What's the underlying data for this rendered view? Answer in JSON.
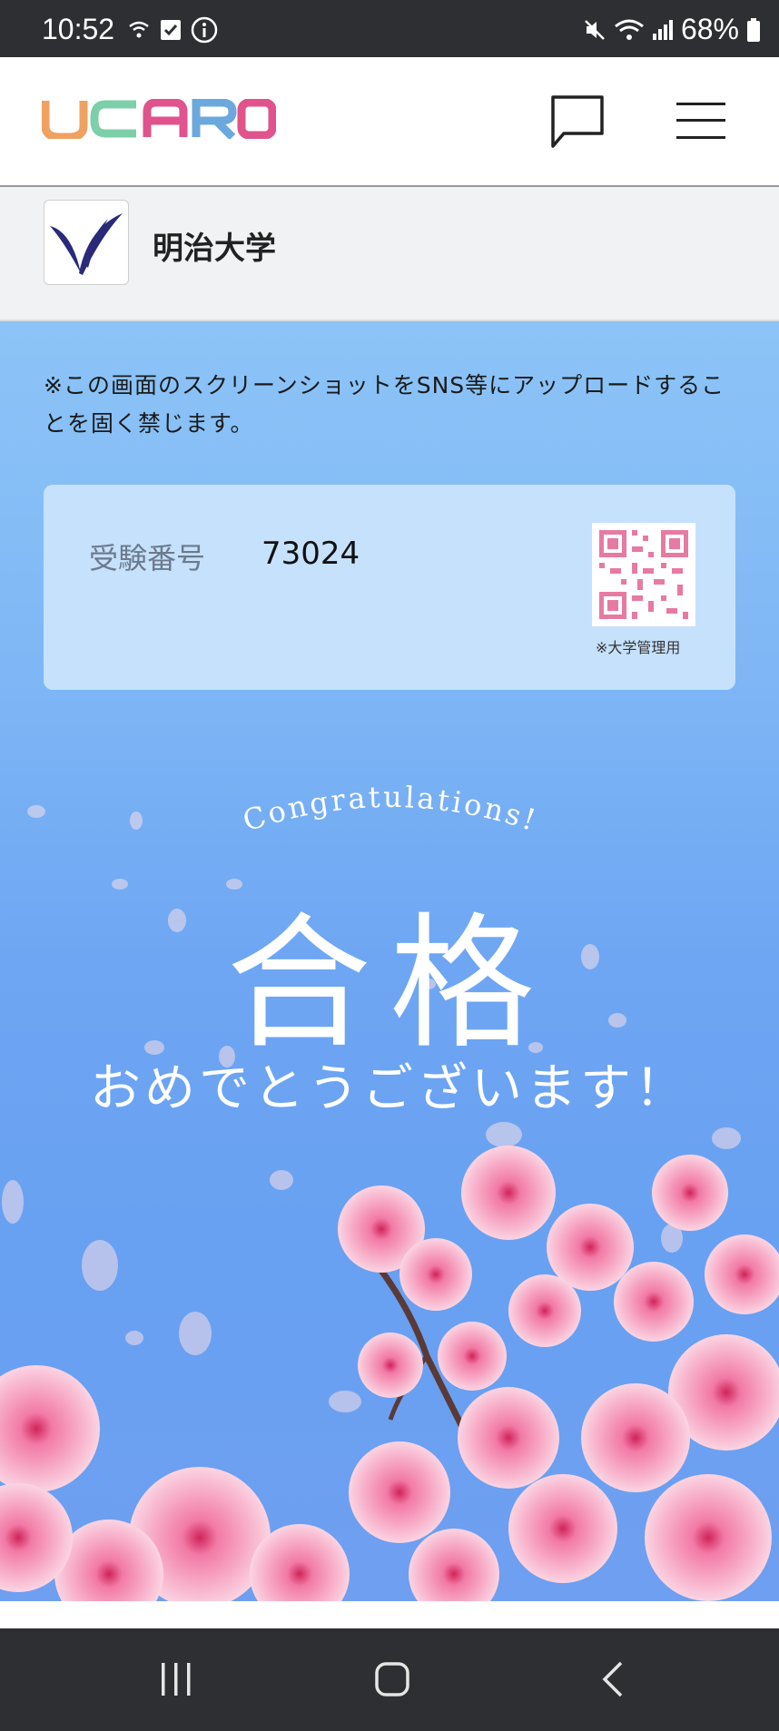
{
  "status_bar": {
    "time": "10:52",
    "battery": "68%"
  },
  "header": {
    "logo_text": "UCARO"
  },
  "university": {
    "name": "明治大学"
  },
  "notice": "※この画面のスクリーンショットをSNS等にアップロードすることを固く禁じます。",
  "exam": {
    "label": "受験番号",
    "value": "73024",
    "qr_note": "※大学管理用"
  },
  "result": {
    "congrats": "Congratulations!",
    "pass": "合格",
    "message": "おめでとうございます！"
  },
  "colors": {
    "status_bar": "#2e2f33",
    "sky_top": "#8cc4f7",
    "sky_bottom": "#6f9ff0",
    "card": "#c6e1fb"
  }
}
